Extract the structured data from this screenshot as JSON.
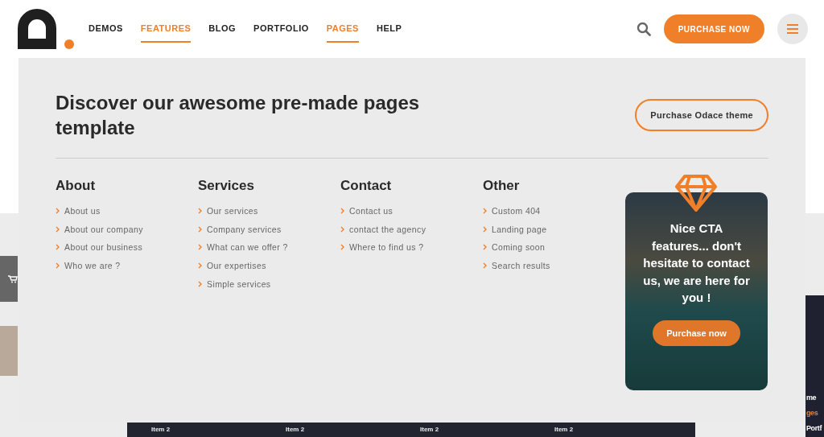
{
  "nav": [
    {
      "label": "DEMOS",
      "selected": false
    },
    {
      "label": "FEATURES",
      "selected": true
    },
    {
      "label": "BLOG",
      "selected": false
    },
    {
      "label": "PORTFOLIO",
      "selected": false
    },
    {
      "label": "PAGES",
      "selected": true
    },
    {
      "label": "HELP",
      "selected": false
    }
  ],
  "header_button": "PURCHASE NOW",
  "panel": {
    "title": "Discover our awesome pre-made pages template",
    "button": "Purchase Odace theme",
    "columns": [
      {
        "heading": "About",
        "items": [
          "About us",
          "About our company",
          "About our business",
          "Who we are ?"
        ]
      },
      {
        "heading": "Services",
        "items": [
          "Our services",
          "Company services",
          "What can we offer ?",
          "Our expertises",
          "Simple services"
        ]
      },
      {
        "heading": "Contact",
        "items": [
          "Contact us",
          "contact the agency",
          "Where to find us ?"
        ]
      },
      {
        "heading": "Other",
        "items": [
          "Custom 404",
          "Landing page",
          "Coming soon",
          "Search results"
        ]
      }
    ],
    "promo": {
      "text": "Nice CTA features... don't hesitate to contact us, we are here for you !",
      "button": "Purchase now"
    }
  },
  "background": {
    "right_preview": [
      {
        "text": "me",
        "color": "#ffffff"
      },
      {
        "text": "ges",
        "color": "#f07f2a"
      },
      {
        "text": "Portf",
        "color": "#ffffff"
      }
    ],
    "bottom_bar": [
      "Item 2",
      "Item 2",
      "Item 2",
      "Item 2"
    ]
  }
}
